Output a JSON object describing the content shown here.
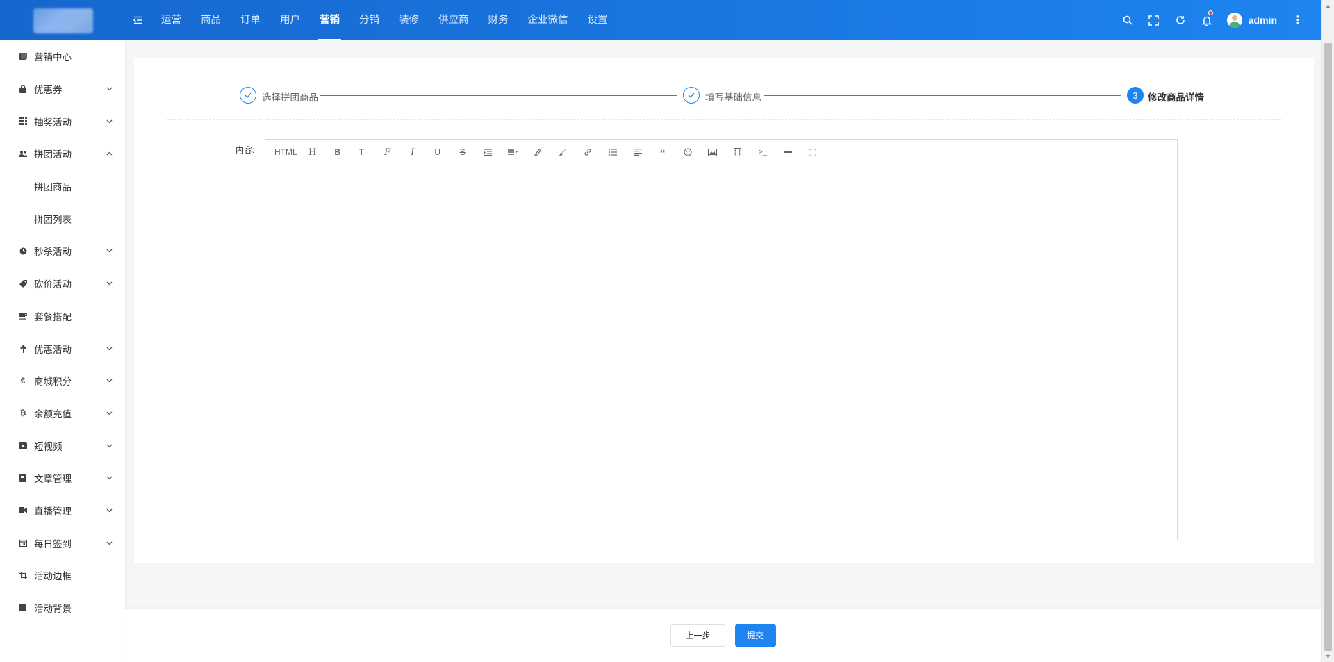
{
  "header": {
    "nav": [
      {
        "label": "运营",
        "active": false
      },
      {
        "label": "商品",
        "active": false
      },
      {
        "label": "订单",
        "active": false
      },
      {
        "label": "用户",
        "active": false
      },
      {
        "label": "营销",
        "active": true
      },
      {
        "label": "分销",
        "active": false
      },
      {
        "label": "装修",
        "active": false
      },
      {
        "label": "供应商",
        "active": false
      },
      {
        "label": "财务",
        "active": false
      },
      {
        "label": "企业微信",
        "active": false
      },
      {
        "label": "设置",
        "active": false
      }
    ],
    "user": {
      "name": "admin"
    },
    "icons": [
      "search-icon",
      "fullscreen-icon",
      "refresh-icon",
      "bell-icon",
      "more-vertical-icon"
    ]
  },
  "sidebar": {
    "items": [
      {
        "label": "营销中心",
        "icon": "marketing-icon",
        "expandable": false,
        "expanded": false
      },
      {
        "label": "优惠券",
        "icon": "lock-icon",
        "expandable": true,
        "expanded": false
      },
      {
        "label": "抽奖活动",
        "icon": "grid-icon",
        "expandable": true,
        "expanded": false
      },
      {
        "label": "拼团活动",
        "icon": "group-icon",
        "expandable": true,
        "expanded": true
      },
      {
        "label": "拼团商品",
        "icon": "",
        "sub": true
      },
      {
        "label": "拼团列表",
        "icon": "",
        "sub": true
      },
      {
        "label": "秒杀活动",
        "icon": "clock-icon",
        "expandable": true,
        "expanded": false
      },
      {
        "label": "砍价活动",
        "icon": "tag-icon",
        "expandable": true,
        "expanded": false
      },
      {
        "label": "套餐搭配",
        "icon": "cup-icon",
        "expandable": false,
        "expanded": false
      },
      {
        "label": "优惠活动",
        "icon": "flower-icon",
        "expandable": true,
        "expanded": false
      },
      {
        "label": "商城积分",
        "icon": "euro-icon",
        "expandable": true,
        "expanded": false
      },
      {
        "label": "余额充值",
        "icon": "bitcoin-icon",
        "expandable": true,
        "expanded": false
      },
      {
        "label": "短视频",
        "icon": "video-icon",
        "expandable": true,
        "expanded": false
      },
      {
        "label": "文章管理",
        "icon": "book-icon",
        "expandable": true,
        "expanded": false
      },
      {
        "label": "直播管理",
        "icon": "camera-icon",
        "expandable": true,
        "expanded": false
      },
      {
        "label": "每日签到",
        "icon": "calendar-icon",
        "expandable": true,
        "expanded": false
      },
      {
        "label": "活动边框",
        "icon": "crop-icon",
        "expandable": false,
        "expanded": false
      },
      {
        "label": "活动背景",
        "icon": "square-icon",
        "expandable": false,
        "expanded": false
      }
    ]
  },
  "steps": [
    {
      "label": "选择拼团商品",
      "status": "done"
    },
    {
      "label": "填写基础信息",
      "status": "done"
    },
    {
      "number": "3",
      "label": "修改商品详情",
      "status": "current"
    }
  ],
  "form": {
    "content_label": "内容:",
    "toolbar": {
      "html_label": "HTML",
      "tools": [
        "heading-icon",
        "bold-icon",
        "font-size-icon",
        "font-family-icon",
        "italic-icon",
        "underline-icon",
        "strikethrough-icon",
        "indent-icon",
        "line-height-icon",
        "font-color-icon",
        "background-color-icon",
        "link-icon",
        "bulleted-list-icon",
        "align-icon",
        "quote-icon",
        "emoji-icon",
        "image-icon",
        "video-icon",
        "code-icon",
        "divider-icon",
        "fullscreen-icon"
      ]
    },
    "content_value": ""
  },
  "footer": {
    "prev_label": "上一步",
    "submit_label": "提交"
  },
  "colors": {
    "header_from": "#1667ce",
    "header_to": "#1d84f0",
    "primary": "#1d84f0",
    "notification_dot": "#f5463c",
    "page_bg": "#f5f6f8"
  }
}
